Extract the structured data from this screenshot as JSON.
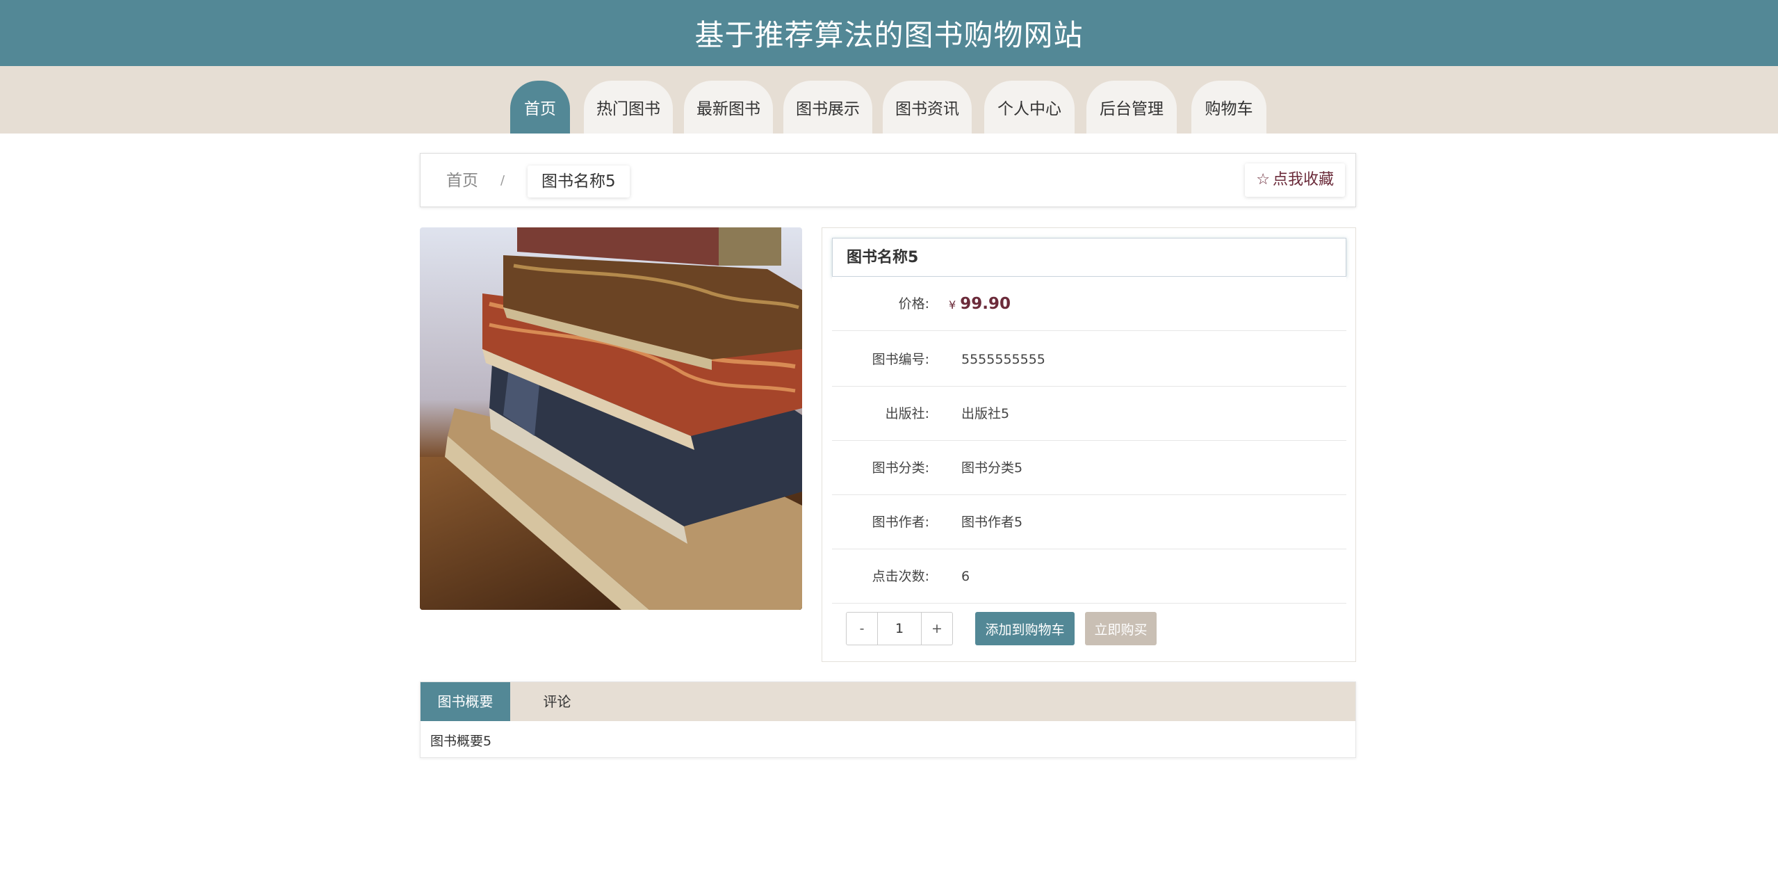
{
  "header": {
    "title": "基于推荐算法的图书购物网站"
  },
  "nav": {
    "items": [
      {
        "label": "首页",
        "active": true
      },
      {
        "label": "热门图书"
      },
      {
        "label": "最新图书"
      },
      {
        "label": "图书展示"
      },
      {
        "label": "图书资讯"
      },
      {
        "label": "个人中心"
      },
      {
        "label": "后台管理"
      },
      {
        "label": "购物车"
      }
    ]
  },
  "breadcrumb": {
    "home": "首页",
    "separator": "/",
    "current": "图书名称5"
  },
  "favorite": {
    "label": "点我收藏",
    "icon": "star-outline-icon"
  },
  "book": {
    "title": "图书名称5",
    "price_currency": "¥",
    "price": "99.90",
    "fields": [
      {
        "label": "图书编号:",
        "value": "5555555555"
      },
      {
        "label": "出版社:",
        "value": "出版社5"
      },
      {
        "label": "图书分类:",
        "value": "图书分类5"
      },
      {
        "label": "图书作者:",
        "value": "图书作者5"
      },
      {
        "label": "点击次数:",
        "value": "6"
      }
    ],
    "price_label": "价格:"
  },
  "actions": {
    "minus": "-",
    "quantity": "1",
    "plus": "+",
    "add_to_cart": "添加到购物车",
    "buy_now": "立即购买"
  },
  "tabs": {
    "items": [
      {
        "label": "图书概要",
        "active": true
      },
      {
        "label": "评论"
      }
    ],
    "content": "图书概要5"
  },
  "colors": {
    "primary": "#538896",
    "secondary": "#e6ded4",
    "price": "#6b2b3a",
    "buy_button": "#c9bfb4"
  }
}
